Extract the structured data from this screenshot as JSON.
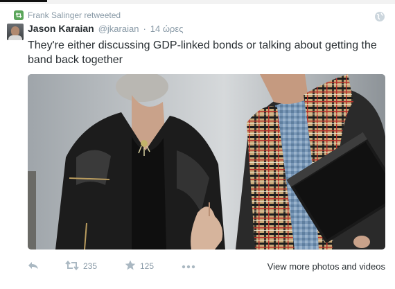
{
  "retweet": {
    "label": "Frank Salinger retweeted"
  },
  "tweet": {
    "author_name": "Jason Karaian",
    "author_handle": "@jkaraian",
    "separator": "·",
    "timestamp": "14 ώρες",
    "text": "They're either discussing GDP-linked bonds or talking about getting the band back together"
  },
  "actions": {
    "retweet_count": "235",
    "favorite_count": "125",
    "view_more_label": "View more photos and videos"
  },
  "icons": {
    "retweet_badge": "retweet-icon",
    "globe": "globe-icon",
    "reply": "reply-icon",
    "retweet": "retweet-icon",
    "favorite": "star-icon",
    "more": "more-dots-icon"
  },
  "colors": {
    "retweet_green": "#5aa55a",
    "muted_text": "#8899a6",
    "primary_text": "#292f33"
  }
}
